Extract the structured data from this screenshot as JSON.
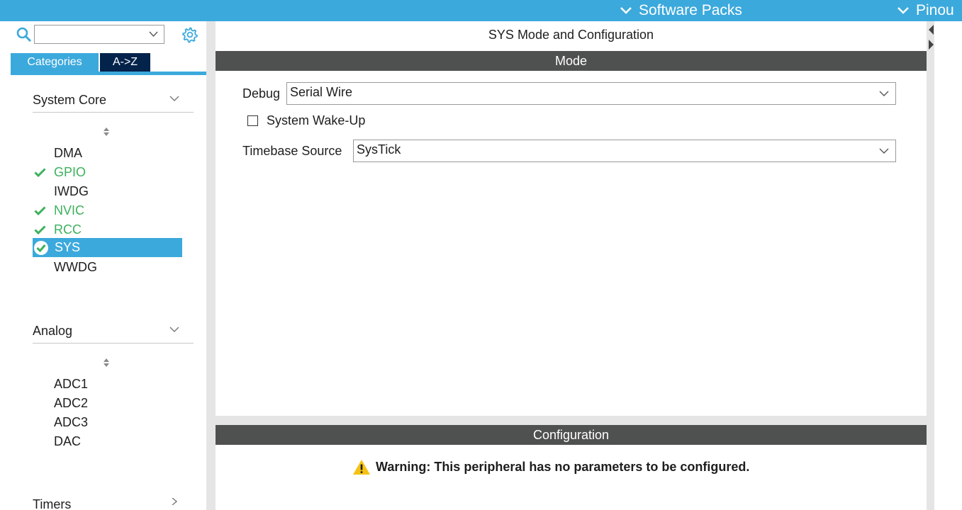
{
  "topbar": {
    "menus": [
      {
        "label": "Software Packs"
      },
      {
        "label": "Pinou"
      }
    ]
  },
  "sidebar": {
    "search": {
      "value": ""
    },
    "tabs": [
      {
        "label": "Categories",
        "active": true
      },
      {
        "label": "A->Z",
        "active": false
      }
    ],
    "categories": [
      {
        "title": "System Core",
        "expanded": true,
        "items": [
          {
            "label": "DMA",
            "status": "none"
          },
          {
            "label": "GPIO",
            "status": "configured"
          },
          {
            "label": "IWDG",
            "status": "none"
          },
          {
            "label": "NVIC",
            "status": "configured"
          },
          {
            "label": "RCC",
            "status": "configured"
          },
          {
            "label": "SYS",
            "status": "selected"
          },
          {
            "label": "WWDG",
            "status": "none"
          }
        ]
      },
      {
        "title": "Analog",
        "expanded": true,
        "items": [
          {
            "label": "ADC1"
          },
          {
            "label": "ADC2"
          },
          {
            "label": "ADC3"
          },
          {
            "label": "DAC"
          }
        ]
      },
      {
        "title": "Timers",
        "expanded": false,
        "items": []
      }
    ]
  },
  "main": {
    "title": "SYS Mode and Configuration",
    "mode_header": "Mode",
    "debug": {
      "label": "Debug",
      "value": "Serial Wire"
    },
    "wakeup": {
      "label": "System Wake-Up",
      "checked": false
    },
    "timebase": {
      "label": "Timebase Source",
      "value": "SysTick"
    },
    "config_header": "Configuration",
    "warning": "Warning: This peripheral has no parameters to be configured."
  },
  "colors": {
    "accent": "#3ca9dc",
    "dark_tab": "#03234b",
    "header_bar": "#4f5150",
    "configured_green": "#3cb15c",
    "warning_yellow": "#f5c211"
  }
}
